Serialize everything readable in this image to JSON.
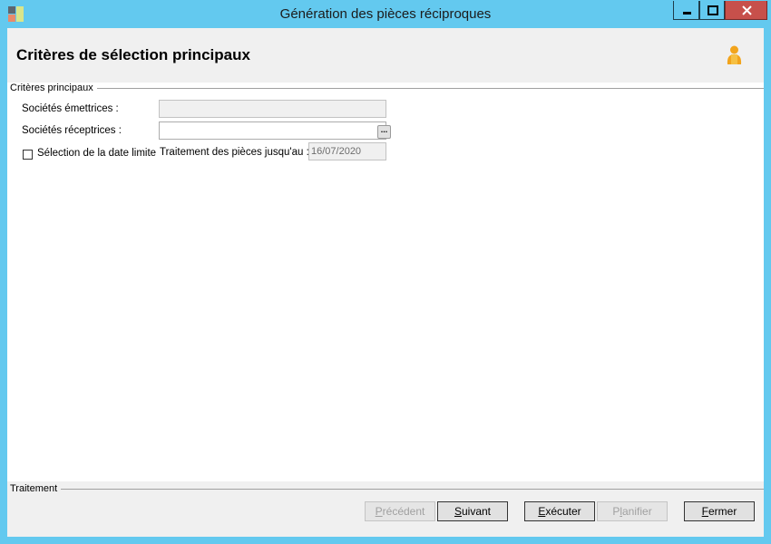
{
  "window": {
    "title": "Génération des pièces réciproques",
    "controls": [
      "minimize-icon",
      "maximize-icon",
      "close-icon"
    ]
  },
  "header": {
    "title": "Critères de sélection principaux",
    "icon": "user-icon"
  },
  "main_group": {
    "label": "Critères principaux",
    "fields": {
      "emettrices_label": "Sociétés émettrices :",
      "emettrices_value": "",
      "receptrices_label": "Sociétés réceptrices :",
      "receptrices_value": "",
      "browse_label": "...",
      "date_limit_label": "Sélection de la date limite",
      "date_limit_checked": false,
      "traitement_label": "Traitement des pièces jusqu'au :",
      "traitement_value": "16/07/2020"
    }
  },
  "footer": {
    "group_label": "Traitement",
    "buttons": {
      "precedent": {
        "pre": "",
        "key": "P",
        "post": "récédent"
      },
      "suivant": {
        "pre": "",
        "key": "S",
        "post": "uivant"
      },
      "executer": {
        "pre": "",
        "key": "E",
        "post": "xécuter"
      },
      "planifier": {
        "pre": "P",
        "key": "l",
        "post": "anifier"
      },
      "fermer": {
        "pre": "",
        "key": "F",
        "post": "ermer"
      }
    }
  },
  "colors": {
    "titlebar": "#63c9ef",
    "close_button": "#c7504b",
    "panel": "#f0f0f0",
    "user_icon": "#f2a41c"
  }
}
